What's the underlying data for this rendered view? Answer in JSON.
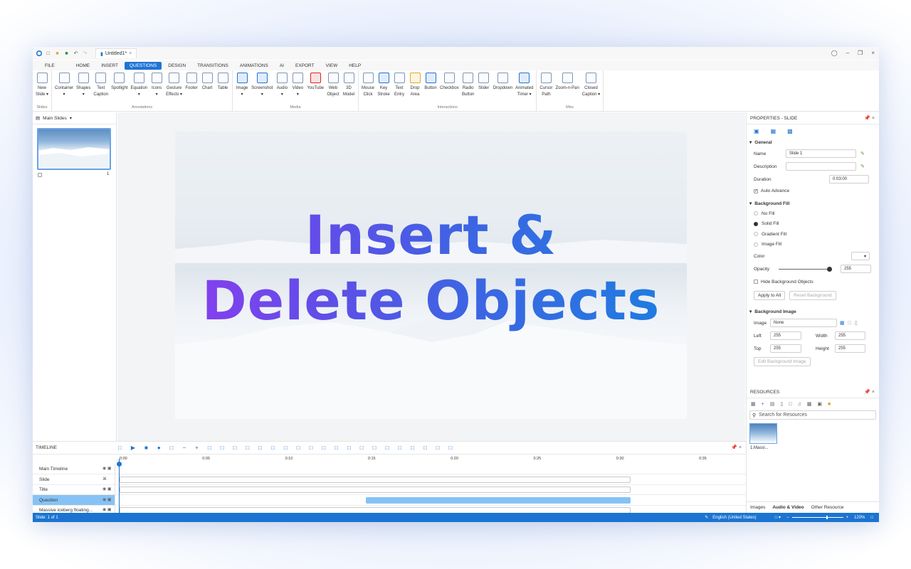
{
  "window": {
    "doc_tab": "Untitled1*"
  },
  "menus": [
    "FILE",
    "HOME",
    "INSERT",
    "QUESTIONS",
    "DESIGN",
    "TRANSITIONS",
    "ANIMATIONS",
    "AI",
    "EXPORT",
    "VIEW",
    "HELP"
  ],
  "active_menu": "QUESTIONS",
  "ribbon": {
    "slides": {
      "label": "Slides",
      "buttons": [
        "New\nSlide ▾"
      ]
    },
    "annotations": {
      "label": "Annotations",
      "buttons": [
        "Container\n▾",
        "Shapes\n▾",
        "Text\nCaption",
        "Spotlight",
        "Equation\n▾",
        "Icons\n▾",
        "Gesture\nEffects ▾",
        "Footer",
        "Chart",
        "Table"
      ]
    },
    "media": {
      "label": "Media",
      "buttons": [
        "Image\n▾",
        "Screenshot\n▾",
        "Audio\n▾",
        "Video\n▾",
        "YouTube",
        "Web\nObject",
        "3D\nModel"
      ]
    },
    "interactions": {
      "label": "Interactions",
      "buttons": [
        "Mouse\nClick",
        "Key\nStroke",
        "Text\nEntry",
        "Drop\nArea",
        "Button",
        "Checkbox",
        "Radio\nButton",
        "Slider",
        "Dropdown",
        "Animated\nTimer ▾"
      ]
    },
    "misc": {
      "label": "Misc",
      "buttons": [
        "Cursor\nPath",
        "Zoom-n-Pan",
        "Closed\nCaption ▾"
      ]
    }
  },
  "left_panel": {
    "title": "Main Slides",
    "slide_number": "1"
  },
  "slide": {
    "line1": "Insert &",
    "line2": "Delete Objects"
  },
  "properties": {
    "title": "PROPERTIES - SLIDE",
    "general": "General",
    "name_label": "Name",
    "name_value": "Slide 1",
    "description_label": "Description",
    "duration_label": "Duration",
    "duration_value": "0:03:00",
    "auto_advance": "Auto Advance",
    "bg_fill": "Background Fill",
    "fill_options": [
      "No Fill",
      "Solid Fill",
      "Gradient Fill",
      "Image Fill"
    ],
    "selected_fill": "Solid Fill",
    "color_label": "Color",
    "opacity_label": "Opacity",
    "opacity_value": "255",
    "hide_bg": "Hide Background Objects",
    "apply_all": "Apply to All",
    "reset_bg": "Reset Background",
    "bg_image": "Background Image",
    "image_label": "Image",
    "image_value": "None",
    "left_label": "Left",
    "left_value": "255",
    "width_label": "Width",
    "width_value": "255",
    "top_label": "Top",
    "top_value": "255",
    "height_label": "Height",
    "height_value": "255",
    "edit_bg": "Edit Background Image"
  },
  "resources": {
    "title": "RESOURCES",
    "search_placeholder": "Search for Resources",
    "item_label": "1.Massi...",
    "tabs": [
      "Images",
      "Audio & Video",
      "Other Resource"
    ],
    "active_tab": "Audio & Video"
  },
  "timeline": {
    "title": "TIMELINE",
    "ticks": [
      "0:00",
      "0:05",
      "0:10",
      "0:15",
      "0:20",
      "0:25",
      "0:30",
      "0:35"
    ],
    "rows": [
      "Main Timeline",
      "Slide",
      "Title",
      "Question",
      "Massive iceberg floating..."
    ]
  },
  "status": {
    "slide": "Slide: 1 of 1",
    "language": "English (United States)",
    "zoom": "120%"
  }
}
